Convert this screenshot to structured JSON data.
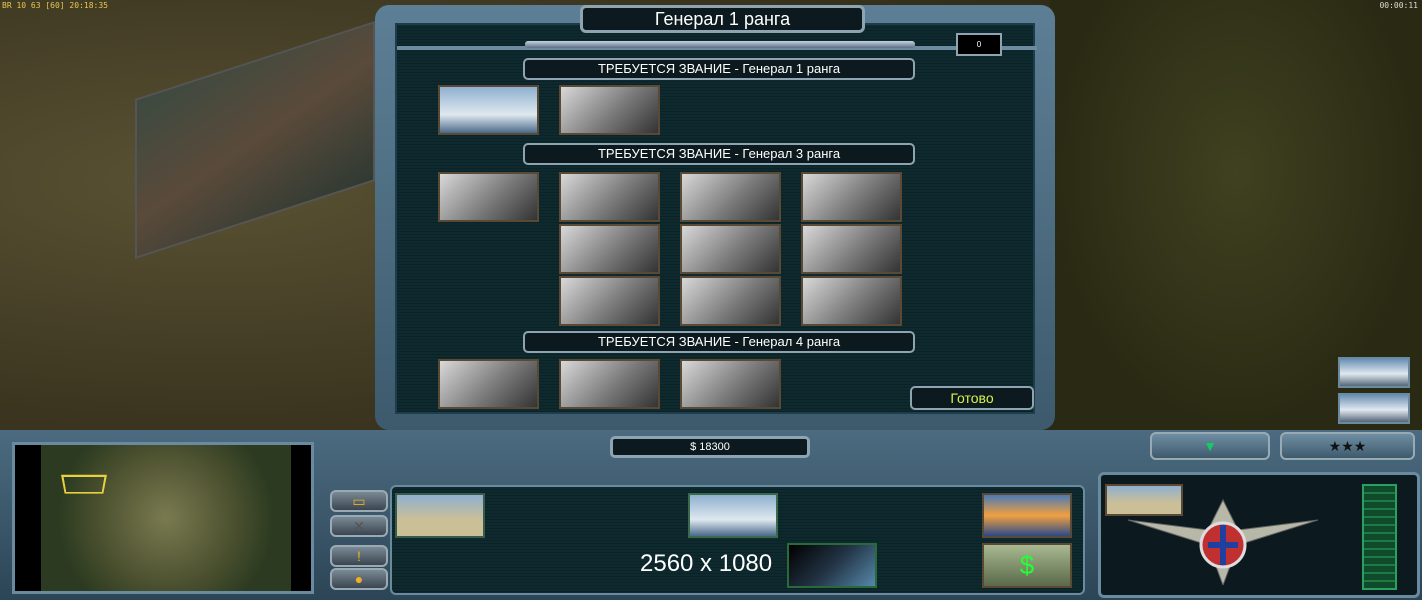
{
  "hud": {
    "stats": "BR 10 63 [60] 20:18:35",
    "game_clock": "00:00:11"
  },
  "dialog": {
    "title": "Генерал 1 ранга",
    "points": "0",
    "sections": [
      {
        "label": "ТРЕБУЕТСЯ ЗВАНИЕ - Генерал 1 ранга",
        "powers": [
          "predator-drone",
          "stealth-fighter"
        ]
      },
      {
        "label": "ТРЕБУЕТСЯ ЗВАНИЕ - Генерал 3 ранга",
        "powers": [
          "pathfinder",
          "paradrop-1",
          "a10-strike-1",
          "emergency-repair-1",
          "paradrop-2",
          "a10-strike-2",
          "emergency-repair-2",
          "paradrop-3",
          "a10-strike-3",
          "emergency-repair-3"
        ]
      },
      {
        "label": "ТРЕБУЕТСЯ ЗВАНИЕ - Генерал 4 ранга",
        "powers": [
          "supply-drop",
          "fuel-air-bomb",
          "spectre-gunship"
        ]
      }
    ],
    "done_label": "Готово"
  },
  "money": "$ 18300",
  "resolution_overlay": "2560 x 1080",
  "colors": {
    "accent_text": "#d8f34a",
    "frame": "#5d7f95",
    "panel": "#0c1a1f",
    "command_icon": "#f2b020"
  }
}
